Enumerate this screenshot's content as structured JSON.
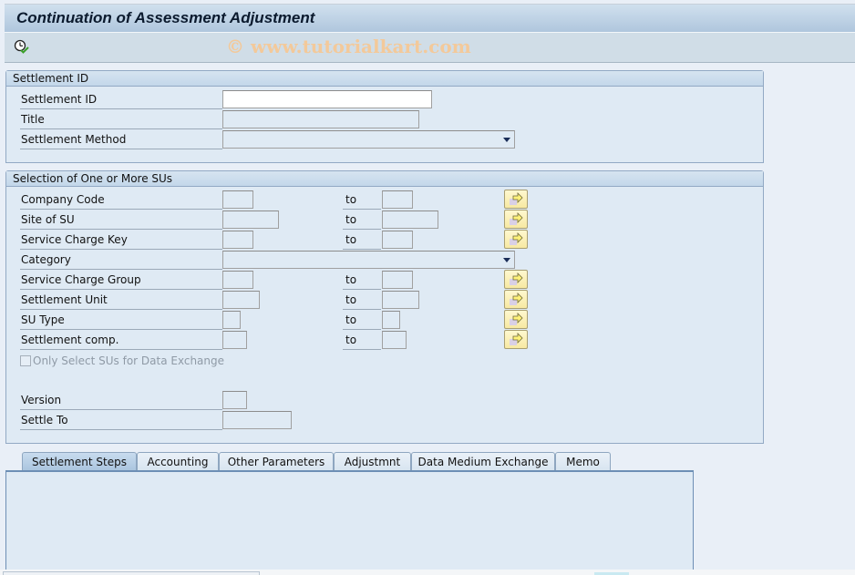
{
  "window": {
    "title": "Continuation of Assessment Adjustment",
    "watermark": "© www.tutorialkart.com"
  },
  "toolbar": {
    "execute_icon": "execute-clock-check-icon"
  },
  "settlement_group": {
    "header": "Settlement ID",
    "fields": [
      {
        "label": "Settlement ID",
        "value": ""
      },
      {
        "label": "Title",
        "value": ""
      },
      {
        "label": "Settlement Method",
        "value": ""
      }
    ]
  },
  "selection_group": {
    "header": "Selection of One or More SUs",
    "to_label": "to",
    "ranges": [
      {
        "label": "Company Code",
        "from": "",
        "to": ""
      },
      {
        "label": "Site of SU",
        "from": "",
        "to": ""
      },
      {
        "label": "Service Charge Key",
        "from": "",
        "to": ""
      },
      {
        "label": "Category",
        "value": ""
      },
      {
        "label": "Service Charge Group",
        "from": "",
        "to": ""
      },
      {
        "label": "Settlement Unit",
        "from": "",
        "to": ""
      },
      {
        "label": "SU Type",
        "from": "",
        "to": ""
      },
      {
        "label": "Settlement comp.",
        "from": "",
        "to": ""
      }
    ],
    "checkbox": {
      "label": "Only Select SUs for Data Exchange",
      "checked": false,
      "enabled": false
    },
    "version": {
      "label": "Version",
      "value": ""
    },
    "settle_to": {
      "label": "Settle To",
      "value": ""
    }
  },
  "tabs": [
    {
      "label": "Settlement Steps",
      "active": true
    },
    {
      "label": "Accounting",
      "active": false
    },
    {
      "label": "Other Parameters",
      "active": false
    },
    {
      "label": "Adjustmnt",
      "active": false
    },
    {
      "label": "Data Medium Exchange",
      "active": false
    },
    {
      "label": "Memo",
      "active": false
    }
  ]
}
